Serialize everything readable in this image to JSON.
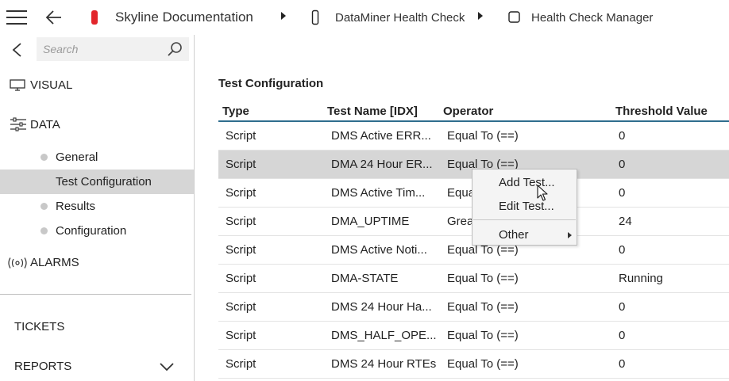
{
  "header": {
    "breadcrumbs": [
      {
        "label": "Skyline Documentation",
        "icon": "red-bookmark-icon",
        "color": "#e2252b"
      },
      {
        "label": "DataMiner Health Check",
        "icon": "page-outline-icon"
      },
      {
        "label": "Health Check Manager",
        "icon": "square-outline-icon"
      }
    ]
  },
  "sidebar": {
    "search_placeholder": "Search",
    "sections": {
      "visual": "VISUAL",
      "data": "DATA",
      "alarms": "ALARMS",
      "tickets": "TICKETS",
      "reports": "REPORTS"
    },
    "data_items": [
      {
        "label": "General",
        "selected": false
      },
      {
        "label": "Test Configuration",
        "selected": true
      },
      {
        "label": "Results",
        "selected": false
      },
      {
        "label": "Configuration",
        "selected": false
      }
    ]
  },
  "main": {
    "title": "Test Configuration",
    "columns": [
      "Type",
      "Test Name [IDX]",
      "Operator",
      "Threshold Value"
    ],
    "rows": [
      {
        "type": "Script",
        "name": "DMS Active ERR...",
        "operator": "Equal To (==)",
        "threshold": "0",
        "selected": false
      },
      {
        "type": "Script",
        "name": "DMA 24 Hour ER...",
        "operator": "Equal To (==)",
        "threshold": "0",
        "selected": true
      },
      {
        "type": "Script",
        "name": "DMS Active Tim...",
        "operator": "Equa",
        "threshold": "0",
        "selected": false
      },
      {
        "type": "Script",
        "name": "DMA_UPTIME",
        "operator": "Grea",
        "threshold": "24",
        "selected": false
      },
      {
        "type": "Script",
        "name": "DMS Active Noti...",
        "operator": "Equal To (==)",
        "threshold": "0",
        "selected": false
      },
      {
        "type": "Script",
        "name": "DMA-STATE",
        "operator": "Equal To (==)",
        "threshold": "Running",
        "selected": false
      },
      {
        "type": "Script",
        "name": "DMS 24 Hour Ha...",
        "operator": "Equal To (==)",
        "threshold": "0",
        "selected": false
      },
      {
        "type": "Script",
        "name": "DMS_HALF_OPE...",
        "operator": "Equal To (==)",
        "threshold": "0",
        "selected": false
      },
      {
        "type": "Script",
        "name": "DMS 24 Hour RTEs",
        "operator": "Equal To (==)",
        "threshold": "0",
        "selected": false
      }
    ]
  },
  "context_menu": {
    "items": [
      "Add Test...",
      "Edit Test...",
      "Other"
    ]
  },
  "colors": {
    "accent": "#2f6d8e",
    "selected_row": "#d6d6d6",
    "brand_red": "#e2252b"
  }
}
